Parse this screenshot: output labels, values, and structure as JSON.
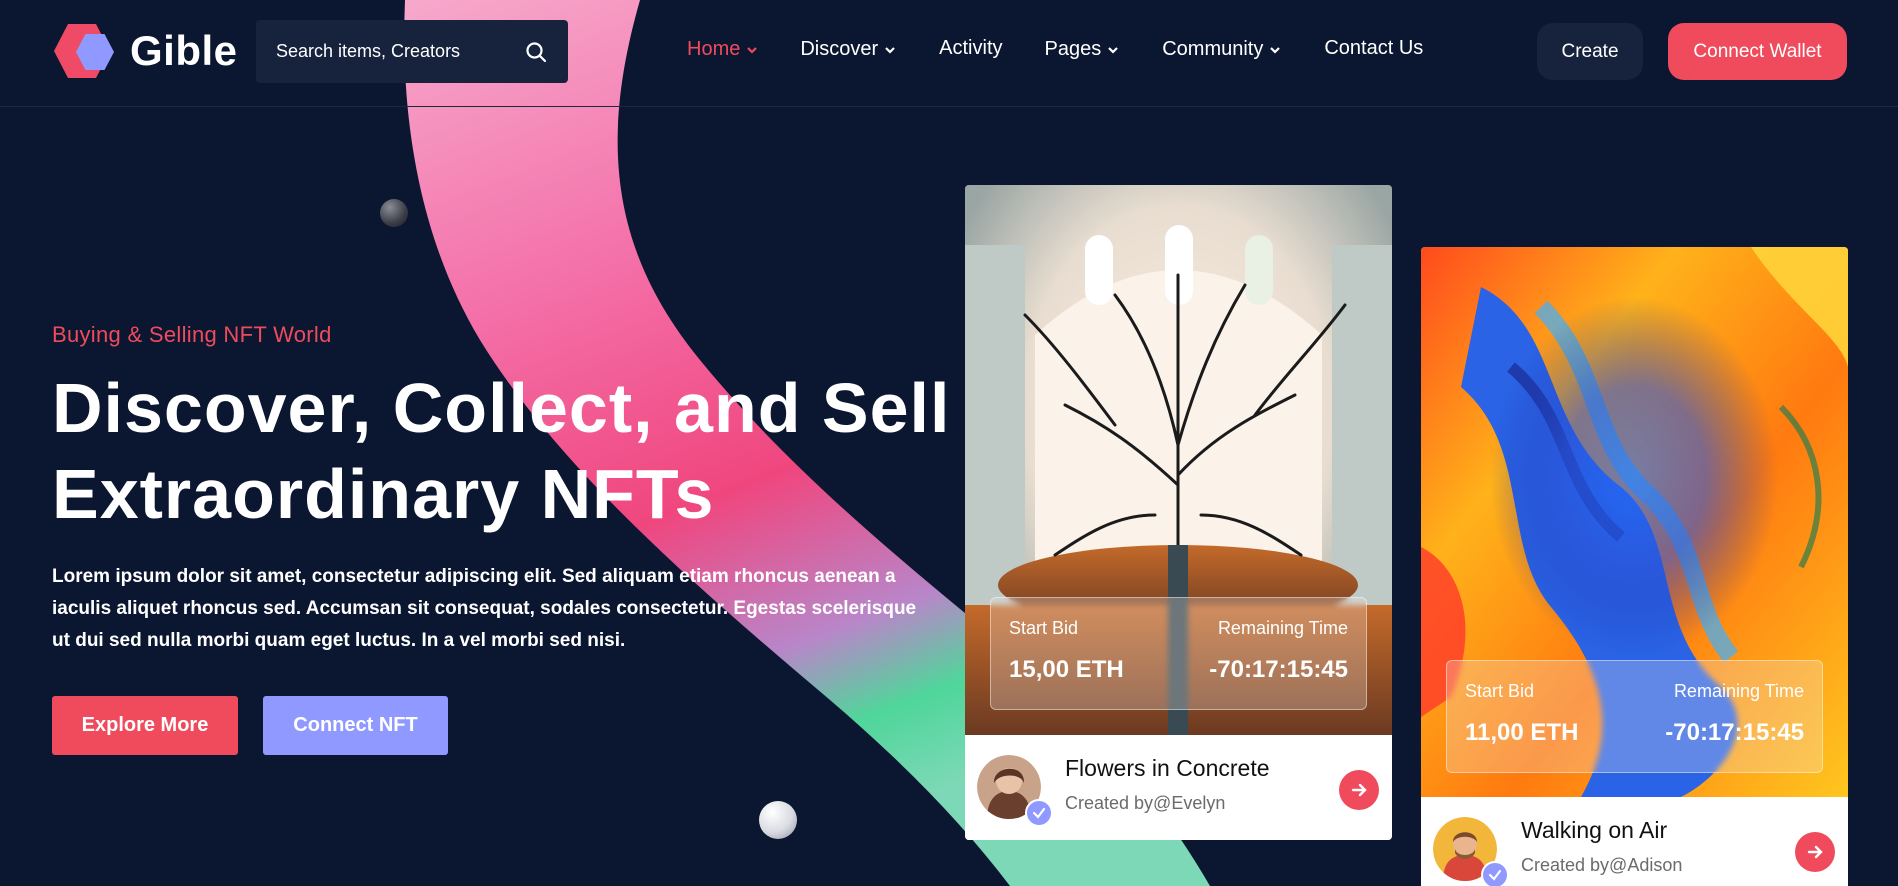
{
  "brand": {
    "name": "Gible"
  },
  "search": {
    "placeholder": "Search items, Creators",
    "icon": "search-icon"
  },
  "nav": {
    "items": [
      {
        "label": "Home",
        "active": true,
        "has_dropdown": true
      },
      {
        "label": "Discover",
        "active": false,
        "has_dropdown": true
      },
      {
        "label": "Activity",
        "active": false,
        "has_dropdown": false
      },
      {
        "label": "Pages",
        "active": false,
        "has_dropdown": true
      },
      {
        "label": "Community",
        "active": false,
        "has_dropdown": true
      },
      {
        "label": "Contact Us",
        "active": false,
        "has_dropdown": false
      }
    ]
  },
  "header": {
    "create_label": "Create",
    "wallet_label": "Connect Wallet"
  },
  "hero": {
    "tagline": "Buying & Selling NFT World",
    "title": "Discover, Collect, and Sell Extraordinary NFTs",
    "text": "Lorem ipsum dolor sit amet, consectetur adipiscing elit. Sed aliquam etiam rhoncus aenean a iaculis aliquet rhoncus sed. Accumsan sit consequat, sodales consectetur. Egestas scelerisque ut dui sed nulla morbi quam eget luctus. In a vel morbi sed nisi.",
    "explore_label": "Explore More",
    "connect_label": "Connect NFT"
  },
  "cards": [
    {
      "title": "Flowers in Concrete",
      "creator": "Created by@Evelyn",
      "bid_label": "Start Bid",
      "bid_value": "15,00 ETH",
      "time_label": "Remaining Time",
      "time_value": "-70:17:15:45"
    },
    {
      "title": "Walking on Air",
      "creator": "Created by@Adison",
      "bid_label": "Start Bid",
      "bid_value": "11,00 ETH",
      "time_label": "Remaining Time",
      "time_value": "-70:17:15:45"
    }
  ],
  "colors": {
    "background": "#0b1630",
    "accent": "#ef4b5d",
    "secondary": "#8f99ff",
    "panel": "#17223d"
  }
}
